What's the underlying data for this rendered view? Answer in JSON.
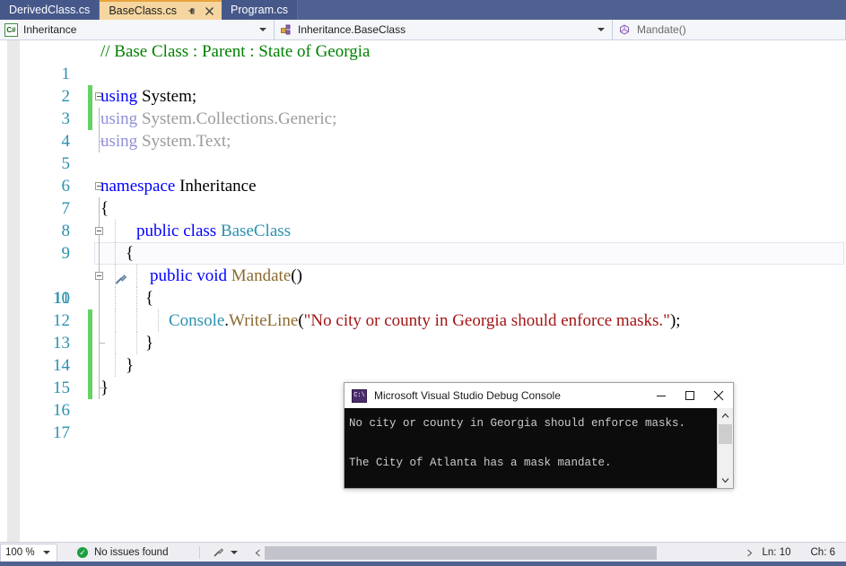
{
  "window": {
    "tabs": [
      {
        "name": "DerivedClass.cs",
        "active": false
      },
      {
        "name": "BaseClass.cs",
        "active": true,
        "pin_icon": "pin-icon",
        "close_icon": "close-icon"
      },
      {
        "name": "Program.cs",
        "active": false
      }
    ]
  },
  "navbar": {
    "project": {
      "icon": "csharp-file-icon",
      "icon_text": "C#",
      "label": "Inheritance"
    },
    "type": {
      "icon": "class-icon",
      "label": "Inheritance.BaseClass"
    },
    "member": {
      "icon": "method-icon",
      "label": "Mandate()"
    }
  },
  "editor": {
    "lines": [
      {
        "num": "1",
        "indent": 0,
        "text": "// Base Class : Parent : State of Georgia"
      },
      {
        "num": "2",
        "indent": 0,
        "text": ""
      },
      {
        "num": "3",
        "indent": 0,
        "text": "using System;"
      },
      {
        "num": "4",
        "indent": 0,
        "text": "using System.Collections.Generic;"
      },
      {
        "num": "5",
        "indent": 0,
        "text": "using System.Text;"
      },
      {
        "num": "6",
        "indent": 0,
        "text": ""
      },
      {
        "num": "7",
        "indent": 0,
        "text": "namespace Inheritance"
      },
      {
        "num": "8",
        "indent": 0,
        "text": "{"
      },
      {
        "num": "9",
        "indent": 1,
        "text": "public class BaseClass"
      },
      {
        "num": "10",
        "indent": 1,
        "text": "{"
      },
      {
        "num": "11",
        "indent": 2,
        "text": "public void Mandate()"
      },
      {
        "num": "12",
        "indent": 2,
        "text": "{"
      },
      {
        "num": "13",
        "indent": 3,
        "text": "Console.WriteLine(\"No city or county in Georgia should enforce masks.\");"
      },
      {
        "num": "14",
        "indent": 2,
        "text": "}"
      },
      {
        "num": "15",
        "indent": 1,
        "text": "}"
      },
      {
        "num": "16",
        "indent": 0,
        "text": "}"
      },
      {
        "num": "17",
        "indent": 0,
        "text": ""
      }
    ],
    "current_line": "10",
    "quick_actions_icon": "screwdriver-quick-actions-icon",
    "colors": {
      "comment": "#008000",
      "keyword": "#0000ff",
      "type": "#2b91af",
      "string": "#a31515",
      "method": "#8a6a2e",
      "line_number": "#2b91af",
      "change_bar": "#63d463"
    }
  },
  "console": {
    "icon": "console-app-icon",
    "icon_text": "C:\\",
    "title": "Microsoft Visual Studio Debug Console",
    "buttons": {
      "minimize": "minimize-icon",
      "maximize": "maximize-icon",
      "close": "close-icon"
    },
    "output": "No city or county in Georgia should enforce masks.\n\nThe City of Atlanta has a mask mandate.",
    "scrollbar": {
      "up": "scroll-up-arrow-icon",
      "down": "scroll-down-arrow-icon"
    }
  },
  "statusbar": {
    "zoom": "100 %",
    "issues_icon": "check-circle-icon",
    "issues": "No issues found",
    "source_control_icon": "source-control-icon",
    "scroll_left_icon": "scroll-left-arrow-icon",
    "scroll_right_icon": "scroll-right-arrow-icon",
    "line": "Ln: 10",
    "column": "Ch: 6"
  }
}
